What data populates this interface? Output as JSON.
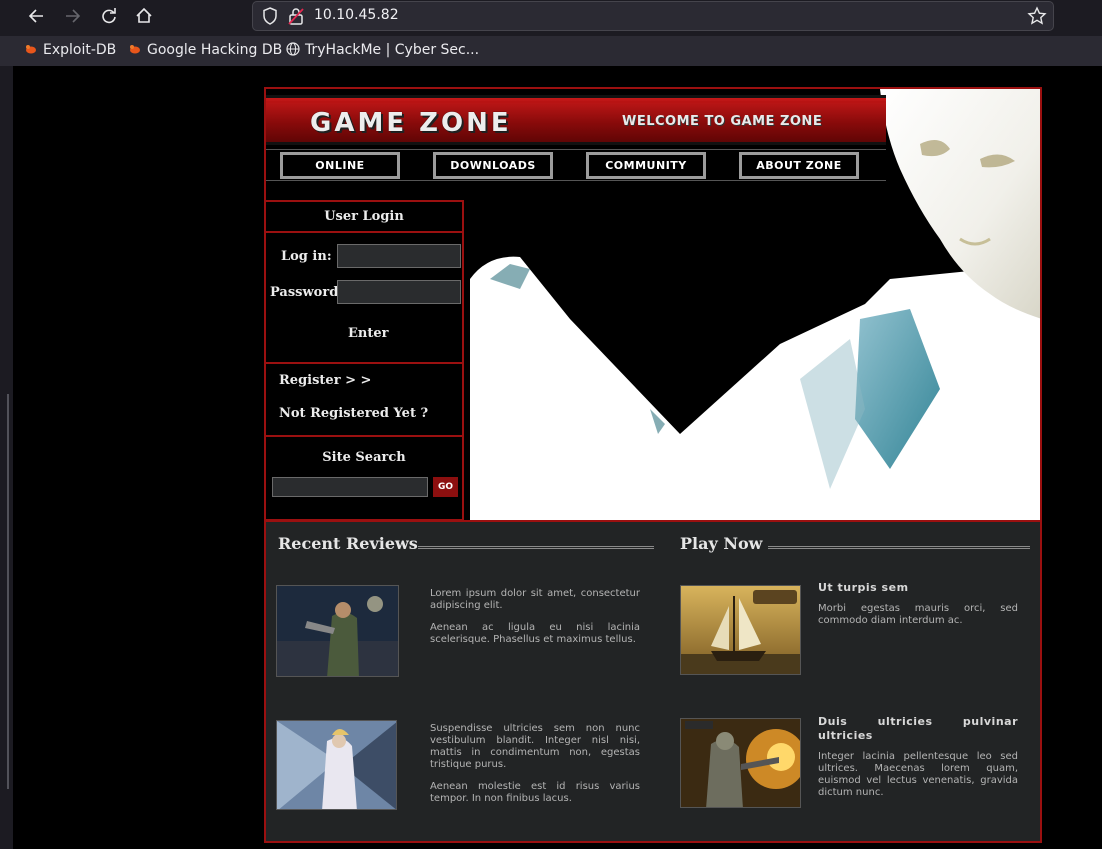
{
  "browser": {
    "url": "10.10.45.82",
    "bookmarks": [
      "Exploit-DB",
      "Google Hacking DB",
      "TryHackMe | Cyber Sec..."
    ]
  },
  "site": {
    "logo": "GAME ZONE",
    "welcome": "WELCOME TO GAME ZONE",
    "nav": [
      "ONLINE",
      "DOWNLOADS",
      "COMMUNITY",
      "ABOUT ZONE"
    ],
    "login": {
      "title": "User Login",
      "login_label": "Log in:",
      "password_label": "Password:",
      "enter_label": "Enter"
    },
    "register": {
      "register_label": "Register > >",
      "not_registered": "Not Registered Yet ?"
    },
    "search": {
      "title": "Site Search",
      "go_label": "GO"
    },
    "reviews": {
      "heading": "Recent Reviews",
      "items": [
        {
          "p1": "Lorem ipsum dolor sit amet, consectetur adipiscing elit.",
          "p2": "Aenean ac ligula eu nisi lacinia scelerisque. Phasellus et maximus tellus."
        },
        {
          "p1": "Suspendisse ultricies sem non nunc vestibulum blandit. Integer nisl nisi, mattis in condimentum non, egestas tristique purus.",
          "p2": "Aenean molestie est id risus varius tempor. In non finibus lacus."
        }
      ]
    },
    "play": {
      "heading": "Play Now",
      "items": [
        {
          "title": "Ut turpis sem",
          "text": "Morbi egestas mauris orci, sed commodo diam interdum ac."
        },
        {
          "title": "Duis ultricies pulvinar ultricies",
          "text": "Integer lacinia pellentesque leo sed ultrices. Maecenas lorem quam, euismod vel lectus venenatis, gravida dictum nunc."
        }
      ]
    }
  },
  "colors": {
    "accent_red": "#9b1010",
    "browser_bg": "#1c1b22",
    "content_bg": "#222425"
  }
}
